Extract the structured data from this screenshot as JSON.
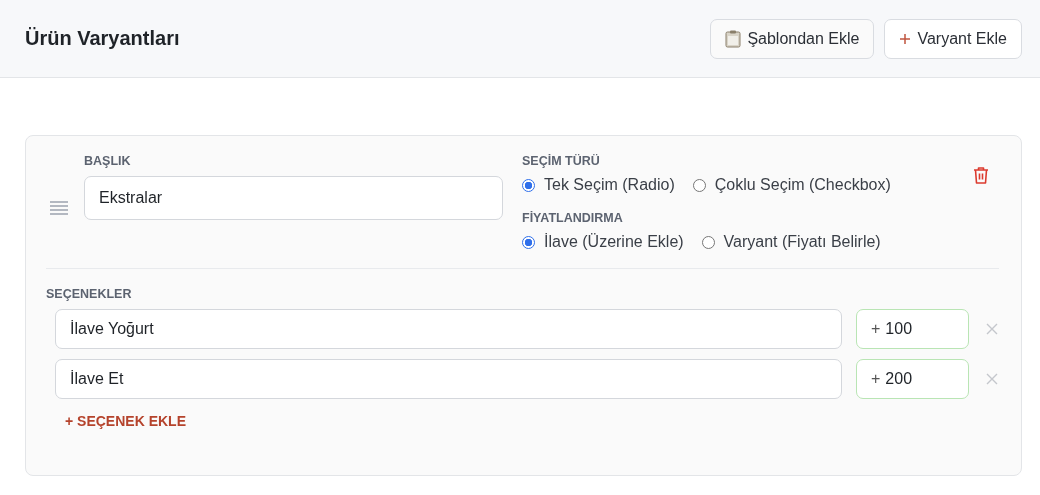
{
  "header": {
    "title": "Ürün Varyantları",
    "buttons": [
      {
        "kind": "template",
        "label": "Şablondan Ekle"
      },
      {
        "kind": "add",
        "label": "Varyant Ekle"
      }
    ]
  },
  "group": {
    "title_label": "BAŞLIK",
    "title_value": "Ekstralar",
    "selection_type": {
      "label": "SEÇİM TÜRÜ",
      "options": [
        {
          "label": "Tek Seçim (Radio)",
          "selected": true
        },
        {
          "label": "Çoklu Seçim (Checkbox)",
          "selected": false
        }
      ]
    },
    "pricing": {
      "label": "FİYATLANDIRMA",
      "options": [
        {
          "label": "İlave (Üzerine Ekle)",
          "selected": true
        },
        {
          "label": "Varyant (Fiyatı Belirle)",
          "selected": false
        }
      ]
    },
    "options_label": "SEÇENEKLER",
    "options": [
      {
        "name": "İlave Yoğurt",
        "price_prefix": "+",
        "price": "100"
      },
      {
        "name": "İlave Et",
        "price_prefix": "+",
        "price": "200"
      }
    ],
    "add_option": "+ SEÇENEK EKLE"
  }
}
